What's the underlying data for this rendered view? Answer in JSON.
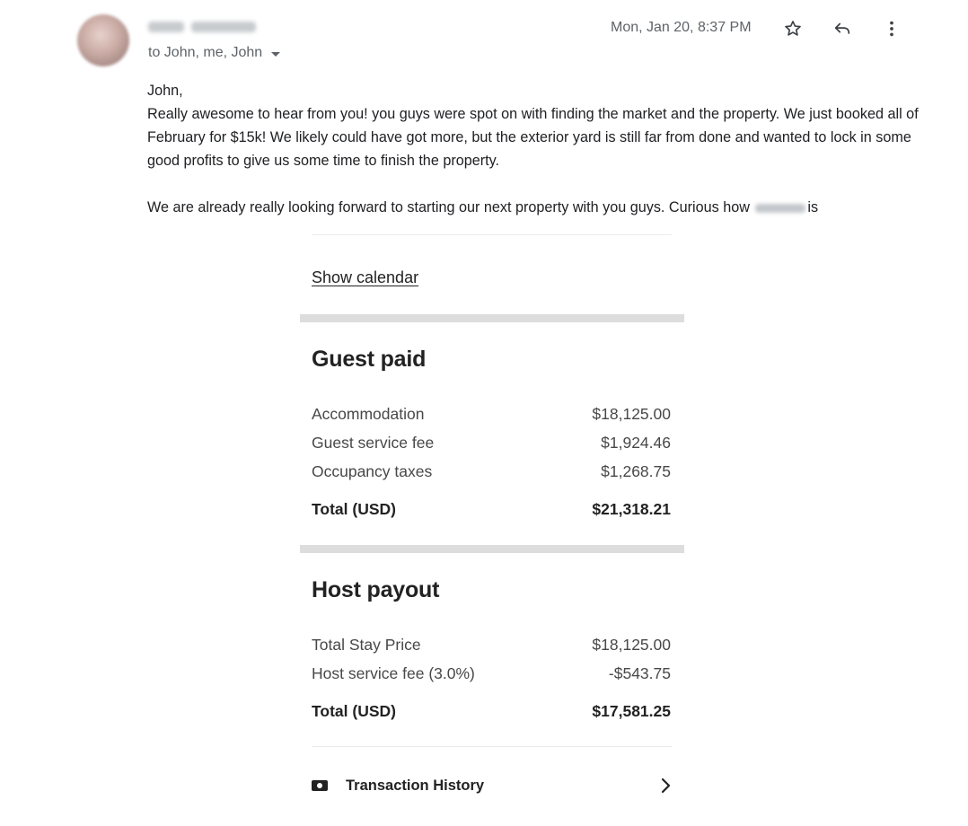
{
  "header": {
    "sender_name": "",
    "recipients": "to John, me, John",
    "date": "Mon, Jan 20, 8:37 PM",
    "icons": [
      "star-icon",
      "reply-icon",
      "more-vert-icon"
    ]
  },
  "message": {
    "greeting": "John,",
    "paragraph1": "Really awesome to hear from you! you guys were spot on with finding the market and the property. We just booked all of February for $15k! We likely could have got more, but the exterior yard is still far from done and wanted to lock in some good profits to give us some time to finish the property.",
    "paragraph2_start": "We are already really looking forward to starting our next property with you guys. Curious how",
    "paragraph2_end": "is"
  },
  "receipt": {
    "show_calendar": "Show calendar",
    "guest_paid": {
      "title": "Guest paid",
      "rows": [
        {
          "label": "Accommodation",
          "value": "$18,125.00"
        },
        {
          "label": "Guest service fee",
          "value": "$1,924.46"
        },
        {
          "label": "Occupancy taxes",
          "value": "$1,268.75"
        }
      ],
      "total_label": "Total (USD)",
      "total_value": "$21,318.21"
    },
    "host_payout": {
      "title": "Host payout",
      "rows": [
        {
          "label": "Total Stay Price",
          "value": "$18,125.00"
        },
        {
          "label": "Host service fee (3.0%)",
          "value": "-$543.75"
        }
      ],
      "total_label": "Total (USD)",
      "total_value": "$17,581.25"
    },
    "transaction_history": "Transaction History"
  }
}
